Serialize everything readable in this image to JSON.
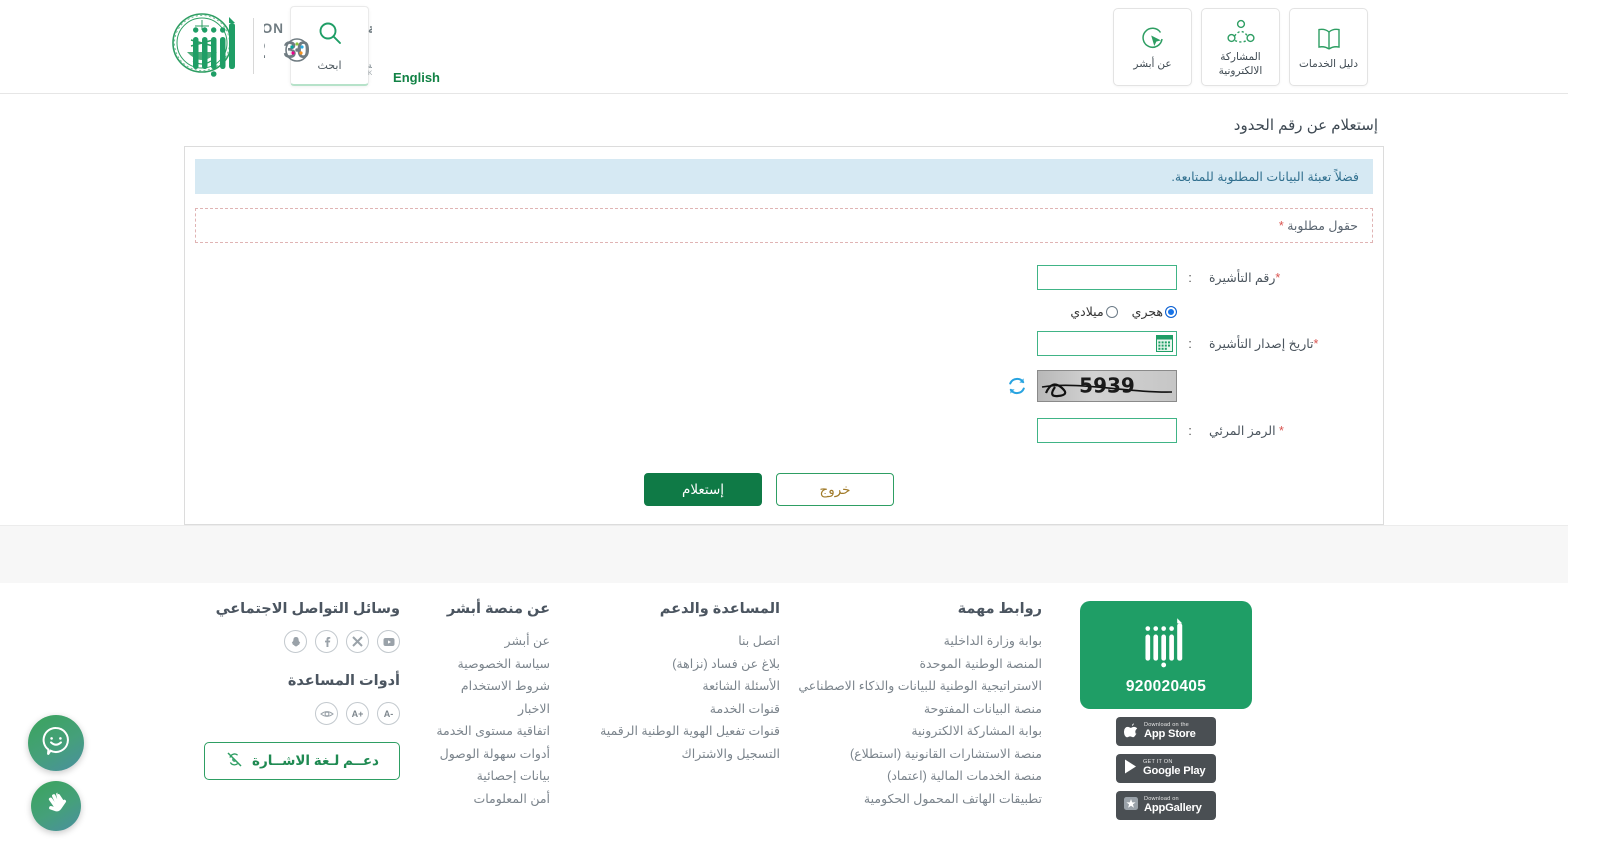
{
  "header": {
    "emblem_alt": "saudi-emblem",
    "search_label": "ابحث",
    "english_label": "English",
    "tiles": [
      {
        "label": "دليل الخدمات",
        "icon": "book-icon"
      },
      {
        "label": "المشاركة الالكترونية",
        "icon": "share-network-icon"
      },
      {
        "label": "عن أبشر",
        "icon": "cursor-circle-icon"
      }
    ],
    "vision_title_ar": "رؤيـــــة",
    "vision_title_en": "VISION",
    "vision_year": "2030",
    "vision_kingdom_ar": "المملكة العربية السعودية",
    "vision_kingdom_en": "KINGDOM OF SAUDI ARABIA"
  },
  "main": {
    "page_title": "إستعلام عن رقم الحدود",
    "info_message": "فضلاً تعبئة البيانات المطلوبة للمتابعة.",
    "required_note": "حقول مطلوبة",
    "required_star": "*",
    "colon": ":",
    "fields": {
      "visa_number": {
        "label": "رقم التأشيرة",
        "value": "",
        "required": true
      },
      "visa_issue_date": {
        "label": "تاريخ إصدار التأشيرة",
        "value": "",
        "required": true,
        "calendar_icon": "calendar-icon"
      },
      "captcha_code": {
        "label": "الرمز المرئي",
        "value": "",
        "required": true
      }
    },
    "calendar_type": {
      "options": [
        {
          "label": "هجري",
          "selected": true
        },
        {
          "label": "ميلادي",
          "selected": false
        }
      ]
    },
    "captcha": {
      "text": "5939",
      "refresh_icon": "refresh-icon"
    },
    "buttons": {
      "submit": "إستعلام",
      "exit": "خروج"
    }
  },
  "footer": {
    "social": {
      "title": "وسائل التواصل الاجتماعي",
      "icons": [
        "snapchat-icon",
        "facebook-icon",
        "x-twitter-icon",
        "youtube-icon"
      ]
    },
    "help_tools": {
      "title": "أدوات المساعدة",
      "icons": [
        "eye-icon",
        "increase-font-icon",
        "decrease-font-icon"
      ],
      "increase_label": "+A",
      "decrease_label": "-A"
    },
    "sign_language": {
      "label": "دعــم لـغة الاشــارة",
      "icon": "sign-language-icon"
    },
    "about": {
      "title": "عن منصة أبشر",
      "items": [
        "عن أبشر",
        "سياسة الخصوصية",
        "شروط الاستخدام",
        "الاخبار",
        "اتفاقية مستوى الخدمة",
        "أدوات سهولة الوصول",
        "بيانات إحصائية",
        "أمن المعلومات"
      ]
    },
    "support": {
      "title": "المساعدة والدعم",
      "items": [
        "اتصل بنا",
        "بلاغ عن فساد (نزاهة)",
        "الأسئلة الشائعة",
        "قنوات الخدمة",
        "قنوات تفعيل الهوية الوطنية الرقمية",
        "التسجيل والاشتراك"
      ]
    },
    "links": {
      "title": "روابط مهمة",
      "items": [
        "بوابة وزارة الداخلية",
        "المنصة الوطنية الموحدة",
        "الاستراتيجية الوطنية للبيانات والذكاء الاصطناعي",
        "منصة البيانات المفتوحة",
        "بوابة المشاركة الالكترونية",
        "منصة الاستشارات القانونية (استطلاع)",
        "منصة الخدمات المالية (اعتماد)",
        "تطبيقات الهاتف المحمول الحكومية"
      ]
    },
    "app": {
      "phone_number": "920020405",
      "stores": [
        {
          "small": "Download on the",
          "big": "App Store",
          "icon": "apple-icon"
        },
        {
          "small": "GET IT ON",
          "big": "Google Play",
          "icon": "play-icon"
        },
        {
          "small": "Download on",
          "big": "AppGallery",
          "icon": "huawei-icon"
        }
      ]
    }
  },
  "floating": {
    "chat": {
      "icon": "chat-smiley-icon"
    },
    "sign": {
      "icon": "sign-hands-icon"
    }
  },
  "colors": {
    "brand_green": "#0f7a46",
    "accent_green": "#1f9e66",
    "info_bg": "#d6e9f3",
    "info_text": "#31708f",
    "required_red": "#d9534f",
    "field_border": "#40b486",
    "radio_blue": "#1673e8"
  }
}
